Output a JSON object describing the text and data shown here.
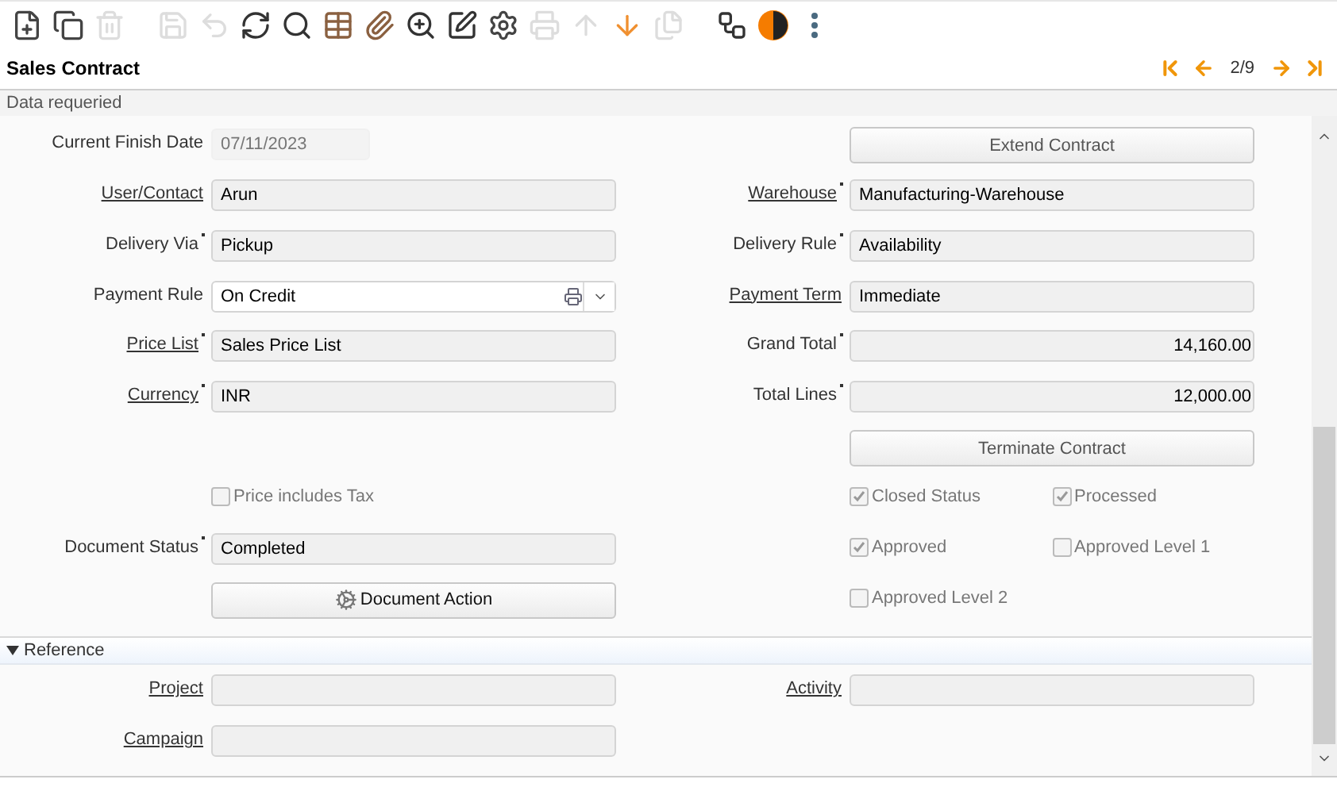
{
  "toolbar": {
    "buttons": [
      {
        "disabled": false
      },
      {
        "disabled": false
      },
      {
        "disabled": true
      },
      {
        "disabled": true
      },
      {
        "disabled": true
      },
      {
        "disabled": false
      },
      {
        "disabled": false
      },
      {
        "disabled": false
      },
      {
        "disabled": false
      },
      {
        "disabled": false
      },
      {
        "disabled": false
      },
      {
        "disabled": false
      },
      {
        "disabled": true
      },
      {
        "disabled": true
      },
      {
        "disabled": false
      },
      {
        "disabled": true
      },
      {
        "disabled": false
      },
      {
        "disabled": false
      },
      {
        "disabled": false
      }
    ]
  },
  "header": {
    "title": "Sales Contract",
    "record": "2/9"
  },
  "status": "Data requeried",
  "form": {
    "rows": [
      {
        "left": {
          "kind": "date",
          "label": "Current Finish Date",
          "link": false,
          "required": false,
          "value": "07/11/2023"
        },
        "right": {
          "kind": "button",
          "label": "Extend Contract"
        }
      },
      {
        "left": {
          "kind": "text",
          "label": "User/Contact",
          "link": true,
          "required": false,
          "value": "Arun"
        },
        "right": {
          "kind": "text",
          "label": "Warehouse",
          "link": true,
          "required": true,
          "value": "Manufacturing-Warehouse"
        }
      },
      {
        "left": {
          "kind": "text",
          "label": "Delivery Via",
          "link": false,
          "required": true,
          "value": "Pickup"
        },
        "right": {
          "kind": "text",
          "label": "Delivery Rule",
          "link": false,
          "required": true,
          "value": "Availability"
        }
      },
      {
        "left": {
          "kind": "select",
          "label": "Payment Rule",
          "link": false,
          "required": false,
          "value": "On Credit"
        },
        "right": {
          "kind": "text",
          "label": "Payment Term",
          "link": true,
          "required": false,
          "value": "Immediate"
        }
      },
      {
        "left": {
          "kind": "text",
          "label": "Price List",
          "link": true,
          "required": true,
          "value": "Sales Price List"
        },
        "right": {
          "kind": "number",
          "label": "Grand Total",
          "link": false,
          "required": true,
          "value": "14,160.00"
        }
      },
      {
        "left": {
          "kind": "text",
          "label": "Currency",
          "link": true,
          "required": true,
          "value": "INR"
        },
        "right": {
          "kind": "number",
          "label": "Total Lines",
          "link": false,
          "required": true,
          "value": "12,000.00"
        }
      },
      {
        "left": {
          "kind": "empty"
        },
        "right": {
          "kind": "button",
          "label": "Terminate Contract"
        }
      },
      {
        "left": {
          "kind": "checks",
          "items": [
            {
              "label": "Price includes Tax",
              "checked": false
            }
          ]
        },
        "right": {
          "kind": "checks",
          "items": [
            {
              "label": "Closed Status",
              "checked": true
            },
            {
              "label": "Processed",
              "checked": true
            }
          ]
        }
      },
      {
        "left": {
          "kind": "text",
          "label": "Document Status",
          "link": false,
          "required": true,
          "value": "Completed"
        },
        "right": {
          "kind": "checks",
          "items": [
            {
              "label": "Approved",
              "checked": true
            },
            {
              "label": "Approved Level 1",
              "checked": false
            }
          ]
        }
      },
      {
        "left": {
          "kind": "action",
          "label": "Document Action"
        },
        "right": {
          "kind": "checks",
          "items": [
            {
              "label": "Approved Level 2",
              "checked": false
            }
          ]
        }
      }
    ],
    "sections": [
      {
        "title": "Reference",
        "expanded": true,
        "rows": [
          {
            "left": {
              "kind": "text",
              "label": "Project",
              "link": true,
              "required": false
            },
            "right": {
              "kind": "text",
              "label": "Activity",
              "link": true,
              "required": false
            }
          },
          {
            "left": {
              "kind": "text",
              "label": "Campaign",
              "link": true,
              "required": false
            },
            "right": {
              "kind": "empty"
            }
          }
        ]
      }
    ]
  }
}
